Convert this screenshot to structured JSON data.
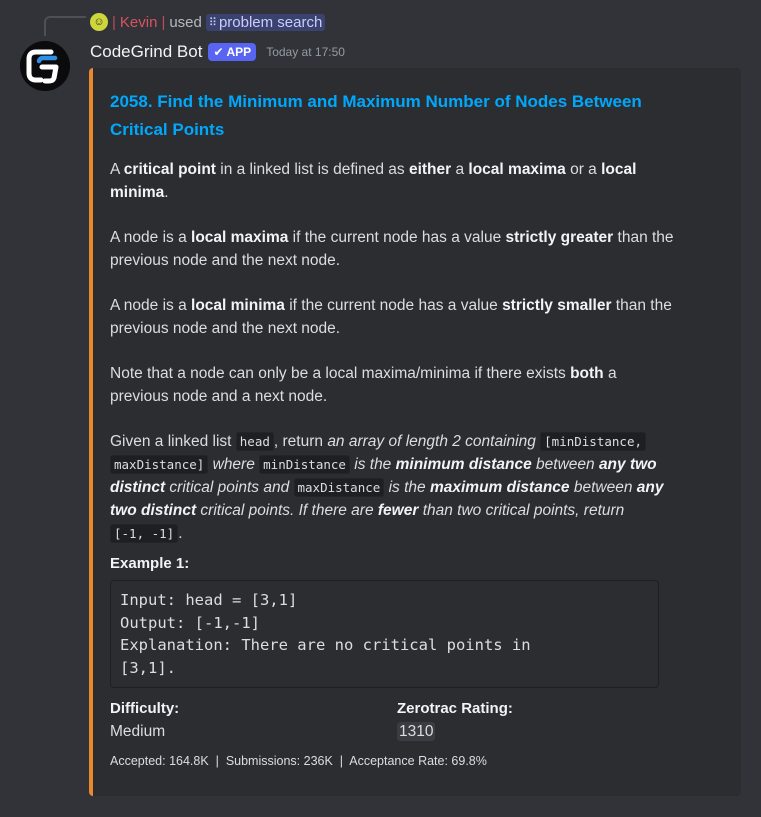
{
  "reply": {
    "user_name": "Kevin",
    "separator_left": "|",
    "separator_right": "|",
    "used_text": "used",
    "command_name": "problem search"
  },
  "message": {
    "bot_name": "CodeGrind Bot",
    "app_tag": "APP",
    "timestamp": "Today at 17:50"
  },
  "embed": {
    "accent_color": "#e8892f",
    "title_line1": "2058. Find the Minimum and Maximum Number of Nodes Between",
    "title_line2": "Critical Points",
    "p1": {
      "t1": "A ",
      "b1": "critical point",
      "t2": " in a linked list is defined as ",
      "b2": "either",
      "t3": " a ",
      "b3": "local maxima",
      "t4": " or a ",
      "b4": "local",
      "b5": "minima",
      "t5": "."
    },
    "p2": {
      "t1": "A node is a ",
      "b1": "local maxima",
      "t2": " if the current node has a value ",
      "b2": "strictly greater",
      "t3": " than the",
      "t4": "previous node and the next node."
    },
    "p3": {
      "t1": "A node is a ",
      "b1": "local minima",
      "t2": " if the current node has a value ",
      "b2": "strictly smaller",
      "t3": " than the",
      "t4": "previous node and the next node."
    },
    "p4": {
      "t1": "Note that a node can only be a local maxima/minima if there exists ",
      "b1": "both",
      "t2": " a",
      "t3": "previous node and a next node."
    },
    "p5": {
      "t1": "Given a linked list ",
      "c1": "head",
      "t2": ", return ",
      "i1": "an array of length 2 containing",
      "c2a": "[minDistance,",
      "c2b": "maxDistance]",
      "i2": " where ",
      "c3": "minDistance",
      "i3": " is the ",
      "bi1": "minimum distance",
      "i4": " between ",
      "bi2": "any two",
      "bi3": "distinct",
      "i5": " critical points and ",
      "c4": "maxDistance",
      "i6": " is the ",
      "bi4": "maximum distance",
      "i7": " between ",
      "bi5": "any",
      "bi6": "two distinct",
      "i8": " critical points. If there are ",
      "bi7": "fewer",
      "i9": " than two critical points, return",
      "c5": "[-1, -1]",
      "t3": "."
    },
    "example_title": "Example 1:",
    "example_lines": [
      "Input: head = [3,1]",
      "Output: [-1,-1]",
      "Explanation: There are no critical points in",
      "[3,1]."
    ],
    "fields": {
      "difficulty_label": "Difficulty:",
      "difficulty_value": "Medium",
      "rating_label": "Zerotrac Rating:",
      "rating_value": "1310"
    },
    "footer": "Accepted: 164.8K  |  Submissions: 236K  |  Acceptance Rate: 69.8%"
  }
}
